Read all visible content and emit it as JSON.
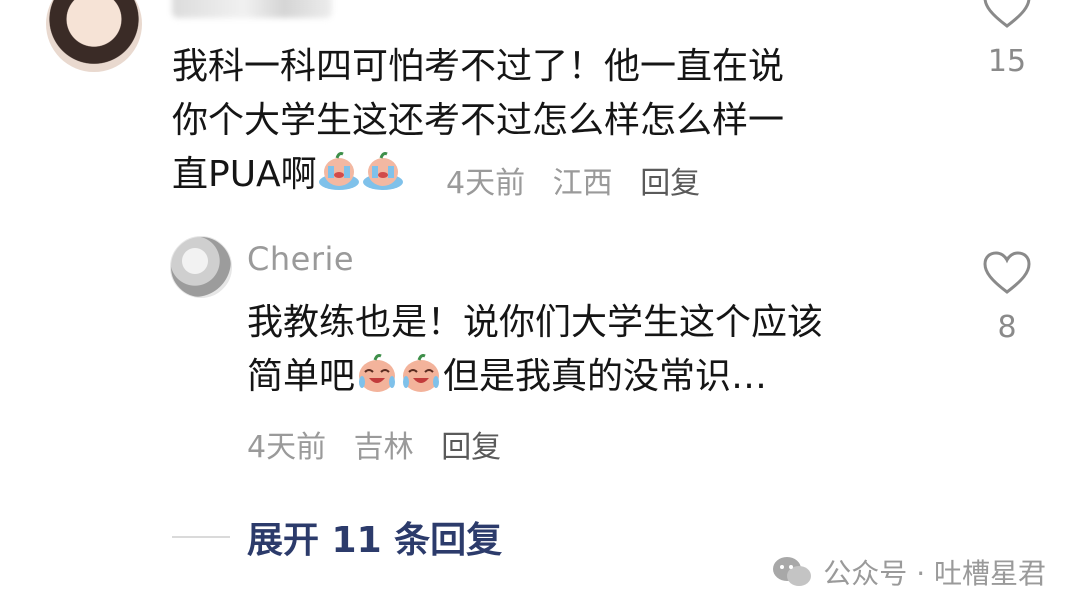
{
  "comments": [
    {
      "username": "",
      "text_line1": "我科一科四可怕考不过了！他一直在说",
      "text_line2": "你个大学生这还考不过怎么样怎么样一",
      "text_line3": "直PUA啊",
      "emojis": [
        "crying-emoji",
        "crying-emoji"
      ],
      "time": "4天前",
      "location": "江西",
      "reply_label": "回复",
      "likes": "15"
    },
    {
      "username": "Cherie",
      "text_line1": "我教练也是！说你们大学生这个应该",
      "text_line2_before": "简单吧",
      "text_line2_after": "但是我真的没常识…",
      "emojis": [
        "tearful-laugh-emoji",
        "tearful-laugh-emoji"
      ],
      "time": "4天前",
      "location": "吉林",
      "reply_label": "回复",
      "likes": "8"
    }
  ],
  "expand_label": "展开 11 条回复",
  "watermark": "公众号 · 吐槽星君",
  "colors": {
    "accent": "#2c3b6b",
    "meta": "#9a9a9a",
    "text": "#151515"
  }
}
